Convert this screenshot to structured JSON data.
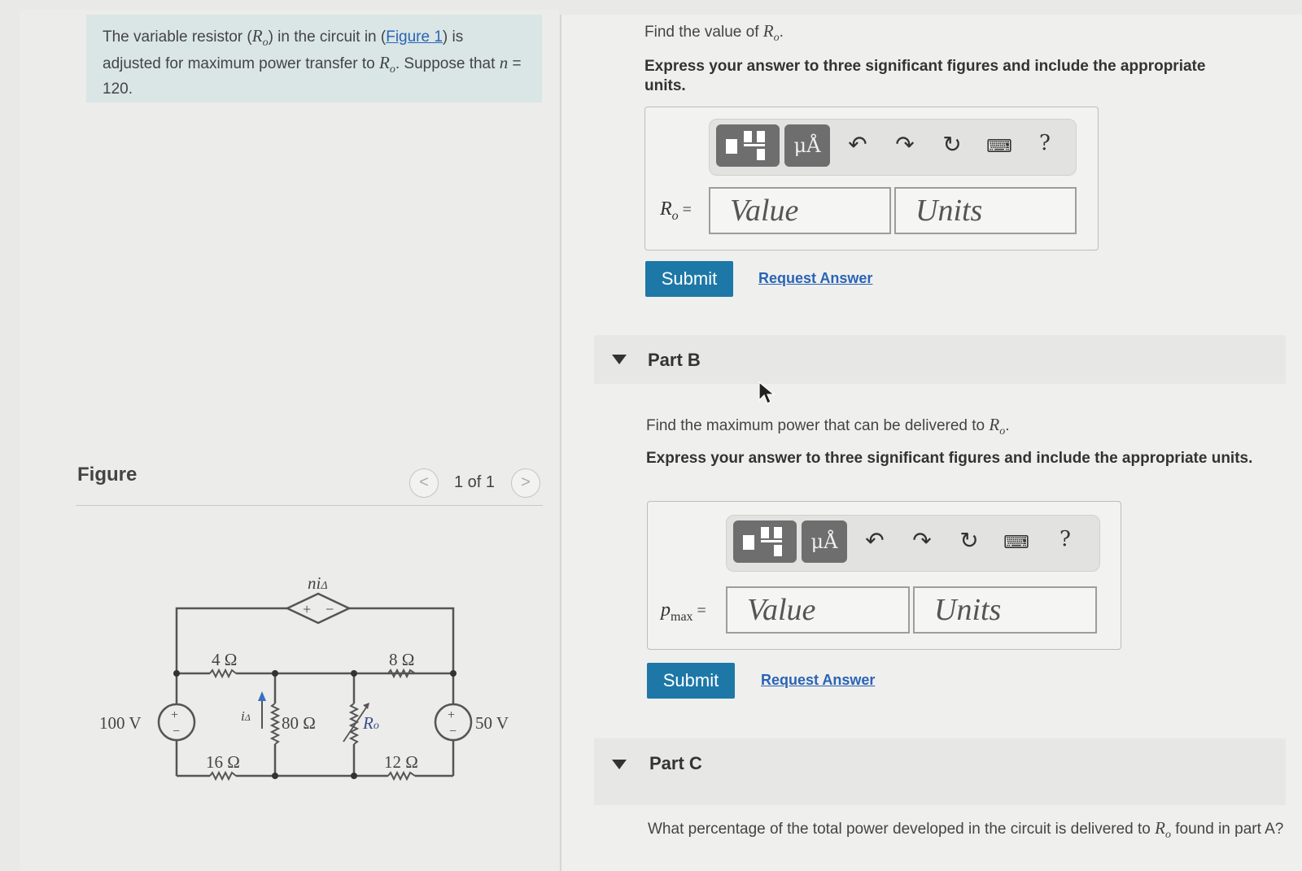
{
  "problem": {
    "text_1": "The variable resistor (",
    "var_R": "R",
    "sub_o": "o",
    "text_2": ") in the circuit in (",
    "figure_link": "Figure 1",
    "text_3": ") is adjusted for maximum power transfer to ",
    "text_4": ". Suppose that ",
    "var_n": "n",
    "text_5": " = 120."
  },
  "figure": {
    "title": "Figure",
    "pager_text": "1 of 1",
    "prev": "<",
    "next": ">"
  },
  "circuit": {
    "labels": {
      "dep_source": "ni",
      "dep_sub": "Δ",
      "r4": "4 Ω",
      "r16": "16 Ω",
      "r80": "80 Ω",
      "r8": "8 Ω",
      "r12": "12 Ω",
      "ro": "R",
      "ro_sub": "o",
      "v100": "100 V",
      "v50": "50 V",
      "i_delta": "i",
      "i_delta_sub": "Δ",
      "plus": "+",
      "minus": "−"
    }
  },
  "partA": {
    "question_1": "Find the value of ",
    "question_end": ".",
    "instruction": "Express your answer to three significant figures and include the appropriate units.",
    "field_label": "R",
    "field_sub": "o",
    "field_eq": " =",
    "value_placeholder": "Value",
    "units_placeholder": "Units",
    "submit": "Submit",
    "request": "Request Answer"
  },
  "partB": {
    "title": "Part B",
    "question_1": "Find the maximum power that can be delivered to ",
    "question_end": ".",
    "instruction": "Express your answer to three significant figures and include the appropriate units.",
    "field_label": "p",
    "field_sub": "max",
    "field_eq": " =",
    "value_placeholder": "Value",
    "units_placeholder": "Units",
    "submit": "Submit",
    "request": "Request Answer"
  },
  "partC": {
    "title": "Part C",
    "question_1": "What percentage of the total power developed in the circuit is delivered to ",
    "question_2": " found in part A?"
  },
  "toolbar": {
    "units_glyph": "μÅ",
    "help": "?",
    "icons": [
      "templates-icon",
      "units-icon",
      "undo-icon",
      "redo-icon",
      "reset-icon",
      "keyboard-icon",
      "help-icon"
    ]
  },
  "colors": {
    "accent": "#1d78a7",
    "link": "#2a64b5",
    "problem_bg": "#d9e6e5"
  }
}
